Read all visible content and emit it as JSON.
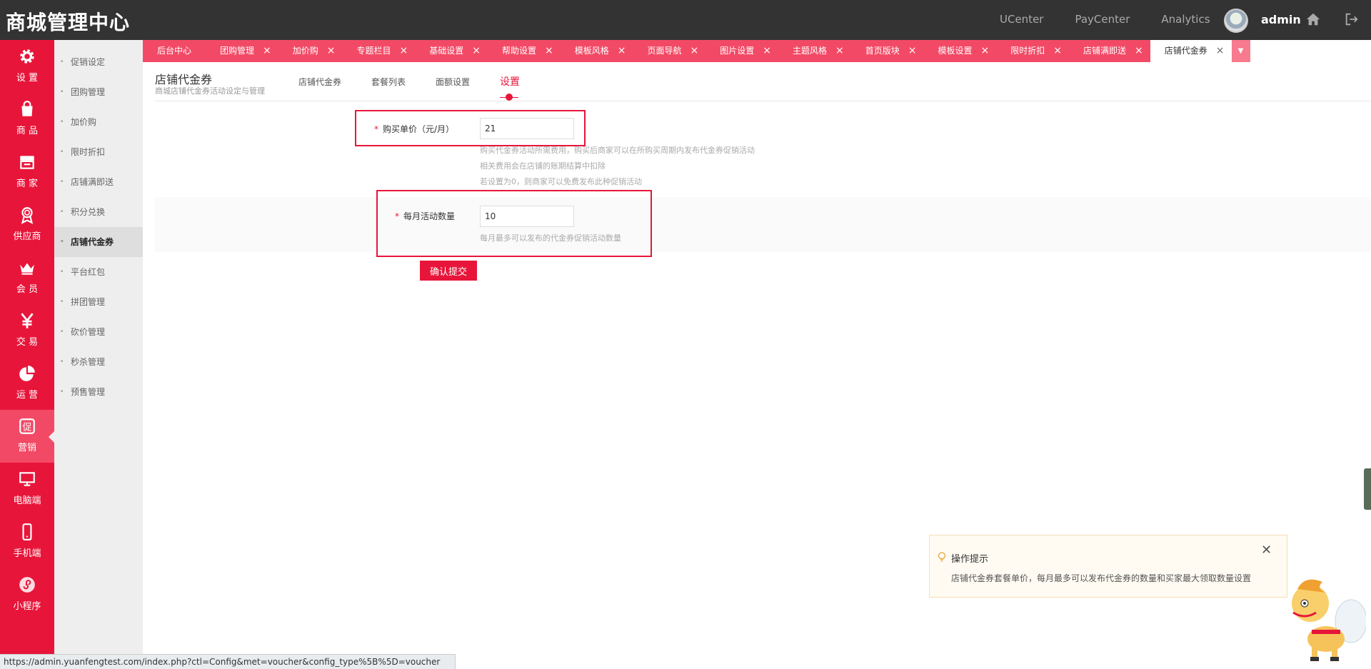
{
  "header": {
    "brand": "商城管理中心",
    "links": [
      "UCenter",
      "PayCenter",
      "Analytics"
    ],
    "username": "admin"
  },
  "rail": {
    "items": [
      {
        "label": "设 置",
        "icon": "gear-icon"
      },
      {
        "label": "商 品",
        "icon": "shopping-bag-icon"
      },
      {
        "label": "商 家",
        "icon": "store-icon"
      },
      {
        "label": "供应商",
        "icon": "medal-icon"
      },
      {
        "label": "会 员",
        "icon": "crown-icon"
      },
      {
        "label": "交 易",
        "icon": "yen-icon"
      },
      {
        "label": "运 营",
        "icon": "pie-chart-icon"
      },
      {
        "label": "营销",
        "icon": "promo-icon"
      },
      {
        "label": "电脑端",
        "icon": "monitor-icon"
      },
      {
        "label": "手机端",
        "icon": "mobile-icon"
      },
      {
        "label": "小程序",
        "icon": "miniprogram-icon"
      }
    ],
    "active_index": 7
  },
  "submenu": {
    "items": [
      "促销设定",
      "团购管理",
      "加价购",
      "限时折扣",
      "店铺满即送",
      "积分兑换",
      "店铺代金券",
      "平台红包",
      "拼团管理",
      "砍价管理",
      "秒杀管理",
      "预售管理"
    ],
    "active_index": 6
  },
  "tabs": {
    "items": [
      "后台中心",
      "团购管理",
      "加价购",
      "专题栏目",
      "基础设置",
      "帮助设置",
      "模板风格",
      "页面导航",
      "图片设置",
      "主题风格",
      "首页版块",
      "模板设置",
      "限时折扣",
      "店铺满即送",
      "店铺代金券"
    ],
    "active_index": 14
  },
  "page": {
    "title": "店铺代金券",
    "subtitle": "商城店铺代金券活动设定与管理",
    "subtabs": [
      "店铺代金券",
      "套餐列表",
      "面额设置",
      "设置"
    ],
    "active_subtab": 3
  },
  "form": {
    "price": {
      "label": "购买单价（元/月）",
      "value": "21",
      "hints": [
        "购买代金券活动所需费用，购买后商家可以在所购买周期内发布代金券促销活动",
        "相关费用会在店铺的账期结算中扣除",
        "若设置为0，则商家可以免费发布此种促销活动"
      ]
    },
    "monthly": {
      "label": "每月活动数量",
      "value": "10",
      "hint": "每月最多可以发布的代金券促销活动数量"
    },
    "submit_label": "确认提交"
  },
  "tip": {
    "title": "操作提示",
    "body": "店铺代金券套餐单价，每月最多可以发布代金券的数量和买家最大领取数量设置"
  },
  "status_url": "https://admin.yuanfengtest.com/index.php?ctl=Config&met=voucher&config_type%5B%5D=voucher",
  "colors": {
    "brand_red": "#e8153a",
    "tab_red": "#f24a66",
    "topbar": "#333333"
  }
}
